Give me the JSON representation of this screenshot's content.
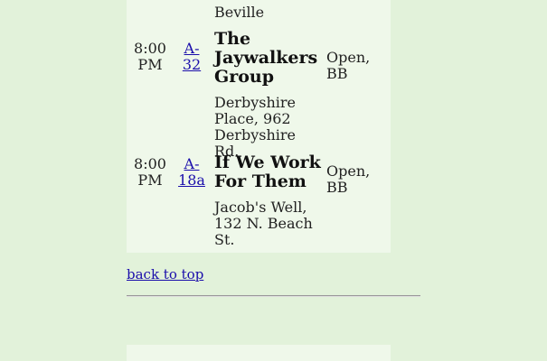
{
  "previous_row": {
    "location_tail": "Beville"
  },
  "meetings": [
    {
      "time": "8:00 PM",
      "code": "A-32",
      "name": "The Jaywalkers Group",
      "location": "Derbyshire Place, 962 Derbyshire Rd.",
      "status": "Open, BB"
    },
    {
      "time": "8:00 PM",
      "code": "A-18a",
      "name": "If We Work For Them",
      "location": "Jacob's Well, 132 N. Beach St.",
      "status": "Open, BB"
    }
  ],
  "footer": {
    "back_to_top": "back to top"
  },
  "colors": {
    "page_bg": "#e2f2da",
    "panel_bg": "#eff8ea",
    "link": "#1a0dab"
  }
}
